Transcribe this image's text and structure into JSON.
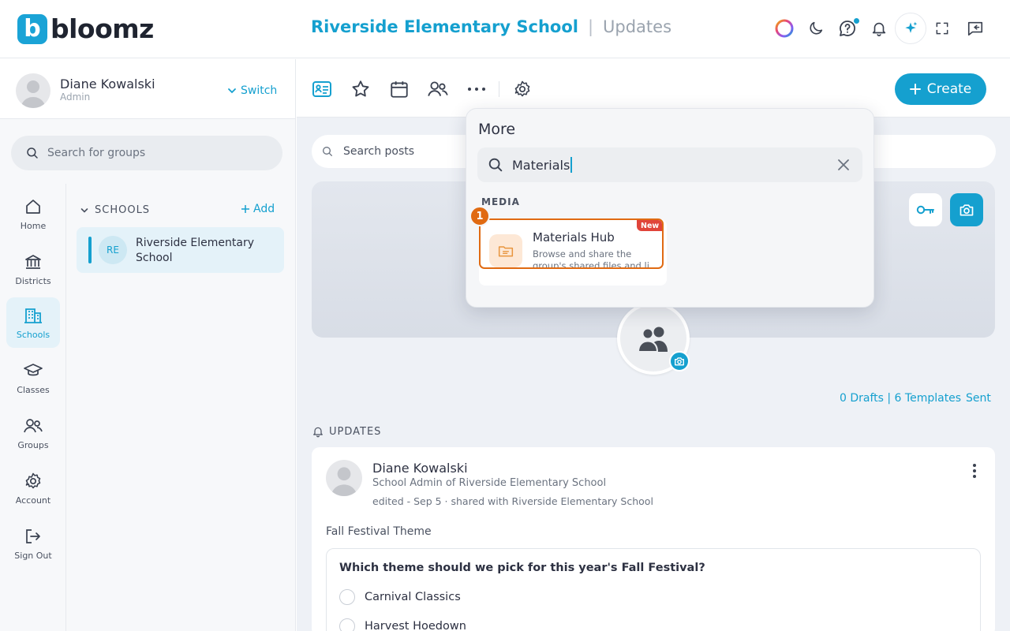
{
  "brand": {
    "logo_letter": "b",
    "logo_word": "bloomz",
    "accent": "#15a0cf"
  },
  "header": {
    "school_name": "Riverside Elementary School",
    "separator": "|",
    "section": "Updates",
    "icons": [
      "color-wheel-icon",
      "moon-icon",
      "help-bubble-icon",
      "bell-icon",
      "sparkle-ai-icon",
      "fullscreen-icon",
      "feedback-icon"
    ]
  },
  "profile": {
    "name": "Diane Kowalski",
    "role": "Admin",
    "switch_label": "Switch"
  },
  "group_search": {
    "placeholder": "Search for groups"
  },
  "nav": {
    "items": [
      {
        "label": "Home",
        "icon": "home-icon"
      },
      {
        "label": "Districts",
        "icon": "bank-icon"
      },
      {
        "label": "Schools",
        "icon": "building-icon",
        "active": true
      },
      {
        "label": "Classes",
        "icon": "graduation-cap-icon"
      },
      {
        "label": "Groups",
        "icon": "people-icon"
      },
      {
        "label": "Account",
        "icon": "gear-icon"
      },
      {
        "label": "Sign Out",
        "icon": "sign-out-icon"
      }
    ]
  },
  "schools_panel": {
    "heading": "SCHOOLS",
    "add_label": "Add",
    "items": [
      {
        "initials": "RE",
        "name": "Riverside Elementary School"
      }
    ]
  },
  "toolbar": {
    "icons": [
      "posts-icon",
      "star-icon",
      "calendar-icon",
      "members-icon",
      "more-dots-icon",
      "settings-icon"
    ],
    "create_label": "Create"
  },
  "post_search": {
    "placeholder": "Search posts"
  },
  "drafts": {
    "label": "0 Drafts | 6 Templates",
    "sent_label": "Sent"
  },
  "updates_heading": "UPDATES",
  "post": {
    "author": "Diane Kowalski",
    "role": "School Admin of Riverside Elementary School",
    "meta": "edited - Sep 5 · shared with Riverside Elementary School",
    "title": "Fall Festival Theme",
    "question": "Which theme should we pick for this year's Fall Festival?",
    "options": [
      "Carnival Classics",
      "Harvest Hoedown"
    ]
  },
  "more_menu": {
    "title": "More",
    "search_value": "Materials",
    "section_label": "MEDIA",
    "step_number": "1",
    "result": {
      "name": "Materials Hub",
      "badge": "New",
      "description": "Browse and share the group's shared files and li"
    }
  }
}
